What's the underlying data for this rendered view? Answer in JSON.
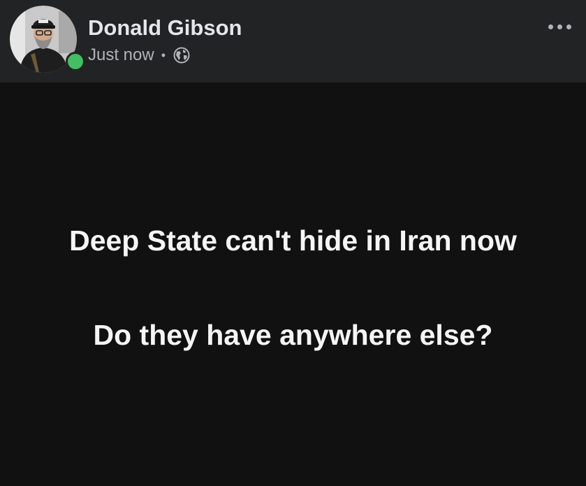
{
  "post": {
    "author": "Donald Gibson",
    "timestamp": "Just now",
    "separator": "•",
    "privacy_icon": "globe-icon",
    "more_icon": "more-options-icon",
    "online": true,
    "online_color": "#45bd62",
    "background_color": "#111111",
    "text_color": "#f5f5f5",
    "lines": [
      "Deep State can't hide in Iran now",
      "Do they have anywhere else?"
    ]
  }
}
